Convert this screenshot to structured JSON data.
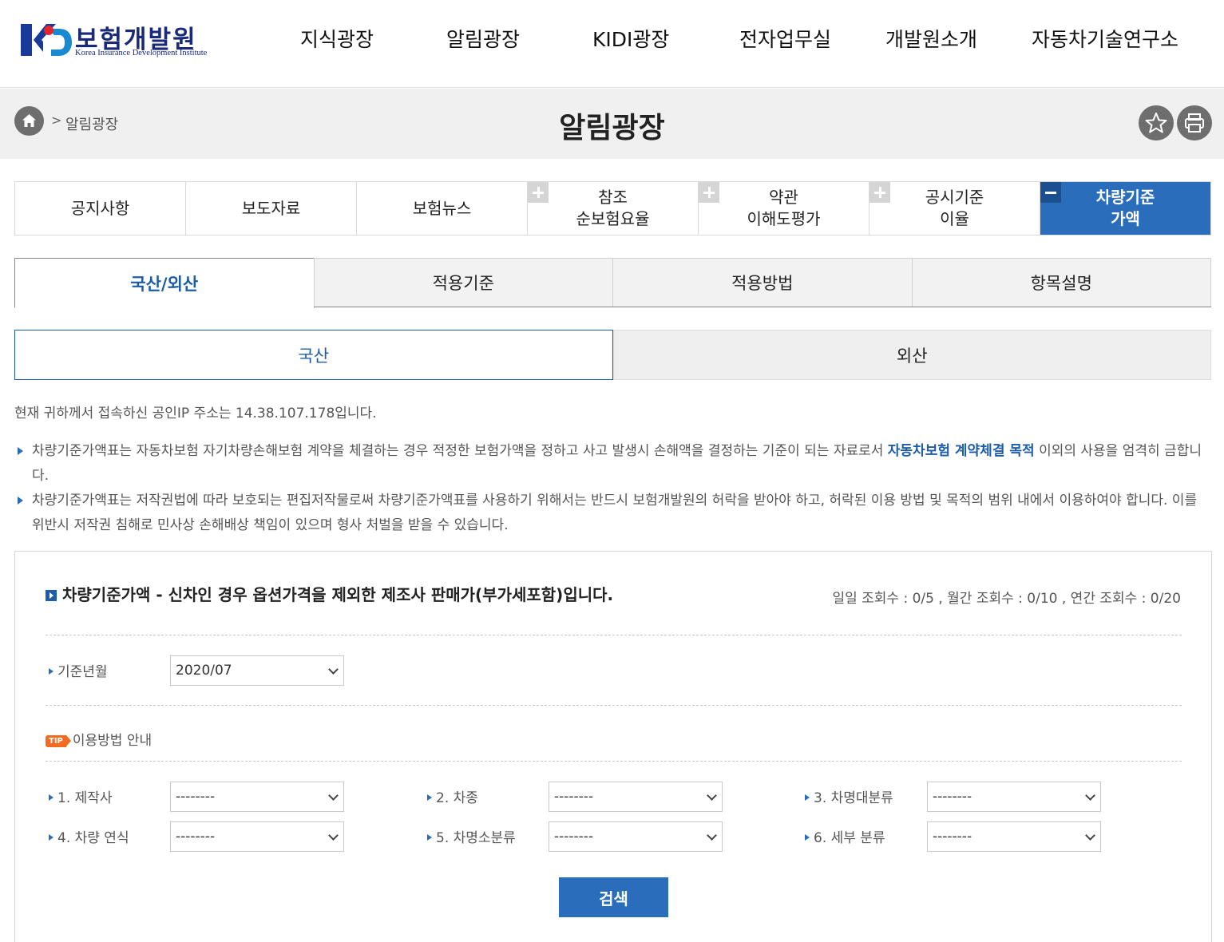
{
  "brand": {
    "name_ko": "보험개발원",
    "name_en": "Korea Insurance Development Institute",
    "primary_color": "#2a6ebb",
    "dark_navy": "#1a2a7a"
  },
  "gnb": {
    "items": [
      "지식광장",
      "알림광장",
      "KIDI광장",
      "전자업무실",
      "개발원소개",
      "자동차기술연구소"
    ]
  },
  "breadcrumb": {
    "home_icon": "home-icon",
    "current": "알림광장"
  },
  "page": {
    "title": "알림광장",
    "actions": [
      "star-icon",
      "print-icon"
    ]
  },
  "submenu": {
    "items": [
      {
        "label": "공지사항",
        "marker": "none"
      },
      {
        "label": "보도자료",
        "marker": "none"
      },
      {
        "label": "보험뉴스",
        "marker": "none"
      },
      {
        "label": "참조\n순보험요율",
        "marker": "plus"
      },
      {
        "label": "약관\n이해도평가",
        "marker": "plus"
      },
      {
        "label": "공시기준\n이율",
        "marker": "plus"
      },
      {
        "label": "차량기준\n가액",
        "marker": "minus",
        "active": true
      }
    ]
  },
  "tabs1": {
    "items": [
      {
        "label": "국산/외산",
        "active": true
      },
      {
        "label": "적용기준"
      },
      {
        "label": "적용방법"
      },
      {
        "label": "항목설명"
      }
    ]
  },
  "tabs2": {
    "items": [
      {
        "label": "국산",
        "active": true
      },
      {
        "label": "외산"
      }
    ]
  },
  "ip_notice": "현재 귀하께서 접속하신 공인IP 주소는 14.38.107.178입니다.",
  "notes": [
    {
      "before": "차량기준가액표는 자동차보험 자기차량손해보험 계약을 체결하는 경우 적정한 보험가액을 정하고 사고 발생시 손해액을 결정하는 기준이 되는 자료로서 ",
      "highlight": "자동차보험 계약체결 목적",
      "after": " 이외의 사용을 엄격히 금합니다."
    },
    {
      "before": "차량기준가액표는 저작권법에 따라 보호되는 편집저작물로써 차량기준가액표를 사용하기 위해서는 반드시 보험개발원의 허락을 받아야 하고, 허락된 이용 방법 및 목적의 범위 내에서 이용하여야 합니다. 이를 위반시 저작권 침해로 민사상 손해배상 책임이 있으며 형사 처벌을 받을 수 있습니다.",
      "highlight": "",
      "after": ""
    }
  ],
  "search": {
    "title": "차량기준가액 - 신차인 경우 옵션가격을 제외한 제조사 판매가(부가세포함)입니다.",
    "counts": "일일 조회수 : 0/5 , 월간 조회수 : 0/10 , 연간 조회수 : 0/20",
    "base_month_label": "기준년월",
    "base_month_value": "2020/07",
    "tip_badge": "TIP",
    "tip_label": "이용방법 안내",
    "fields": [
      {
        "label": "1. 제작사",
        "value": "--------"
      },
      {
        "label": "2. 차종",
        "value": "--------"
      },
      {
        "label": "3. 차명대분류",
        "value": "--------"
      },
      {
        "label": "4. 차량 연식",
        "value": "--------"
      },
      {
        "label": "5. 차명소분류",
        "value": "--------"
      },
      {
        "label": "6. 세부 분류",
        "value": "--------"
      }
    ],
    "button": "검색"
  }
}
